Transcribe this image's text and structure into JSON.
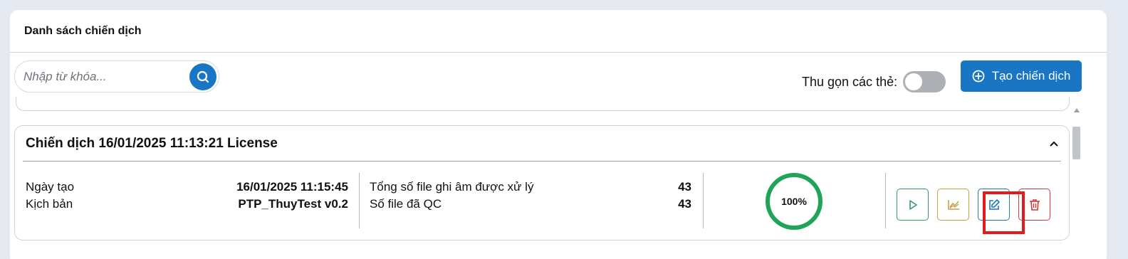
{
  "panel": {
    "title": "Danh sách chiến dịch"
  },
  "search": {
    "placeholder": "Nhập từ khóa...",
    "icon": "search-icon"
  },
  "collapse": {
    "label": "Thu gọn các thẻ:",
    "enabled": false
  },
  "create_button": {
    "label": "Tạo chiến dịch",
    "icon": "plus-circle-icon"
  },
  "campaign": {
    "title": "Chiến dịch 16/01/2025 11:13:21 License",
    "created_label": "Ngày tạo",
    "created_value": "16/01/2025 11:15:45",
    "script_label": "Kịch bản",
    "script_value": "PTP_ThuyTest v0.2",
    "total_label": "Tổng số file ghi âm được xử lý",
    "total_value": "43",
    "qc_label": "Số file đã QC",
    "qc_value": "43",
    "progress": "100%",
    "actions": [
      "play-icon",
      "chart-icon",
      "edit-icon",
      "trash-icon"
    ]
  },
  "colors": {
    "primary": "#1976c4",
    "success": "#1fa45a",
    "warning": "#c9a24a",
    "danger": "#d23a3a",
    "highlight": "#e11b1b"
  }
}
